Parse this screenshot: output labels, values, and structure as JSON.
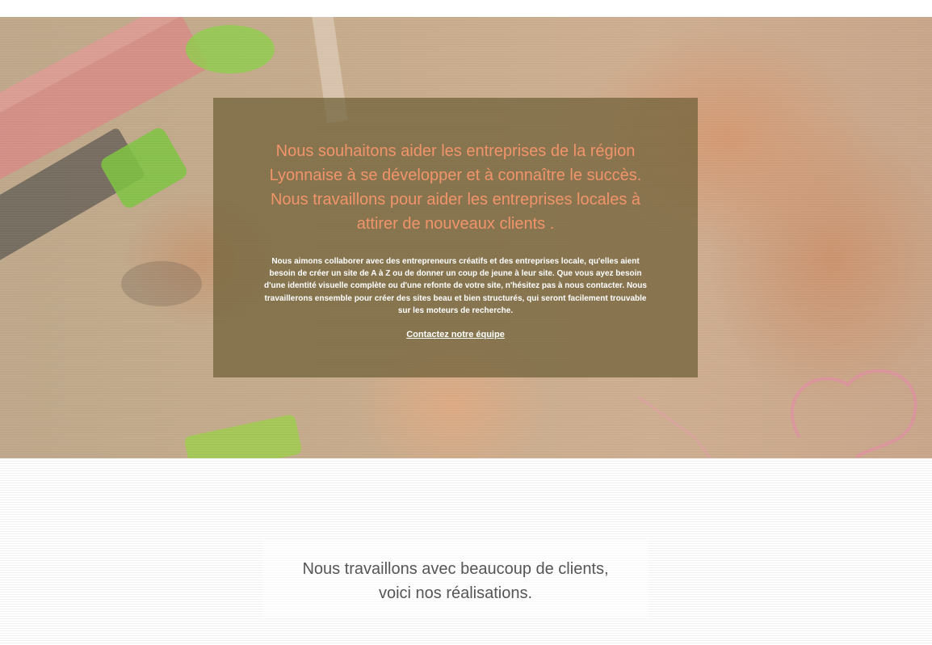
{
  "hero": {
    "headline": "Nous souhaitons aider les entreprises de la région Lyonnaise à se développer et à connaître le succès. Nous travaillons pour aider les entreprises locales à attirer de nouveaux clients .",
    "text": "Nous aimons collaborer avec des entrepreneurs créatifs et des entreprises locale, qu'elles aient besoin de créer un site de A à Z ou de donner un coup de jeune à leur site. Que vous ayez besoin d'une identité visuelle complète ou d'une refonte de votre site, n'hésitez pas à nous contacter. Nous travaillerons ensemble pour créer des sites beau et bien structurés, qui seront facilement trouvable sur les moteurs de recherche.",
    "cta_label": "Contactez notre équipe"
  },
  "section": {
    "title_line1": "Nous travaillons avec beaucoup de clients,",
    "title_line2": "voici nos réalisations."
  },
  "colors": {
    "headline": "#f2946a",
    "card_overlay": "#6e5f37",
    "section_title": "#555555"
  }
}
